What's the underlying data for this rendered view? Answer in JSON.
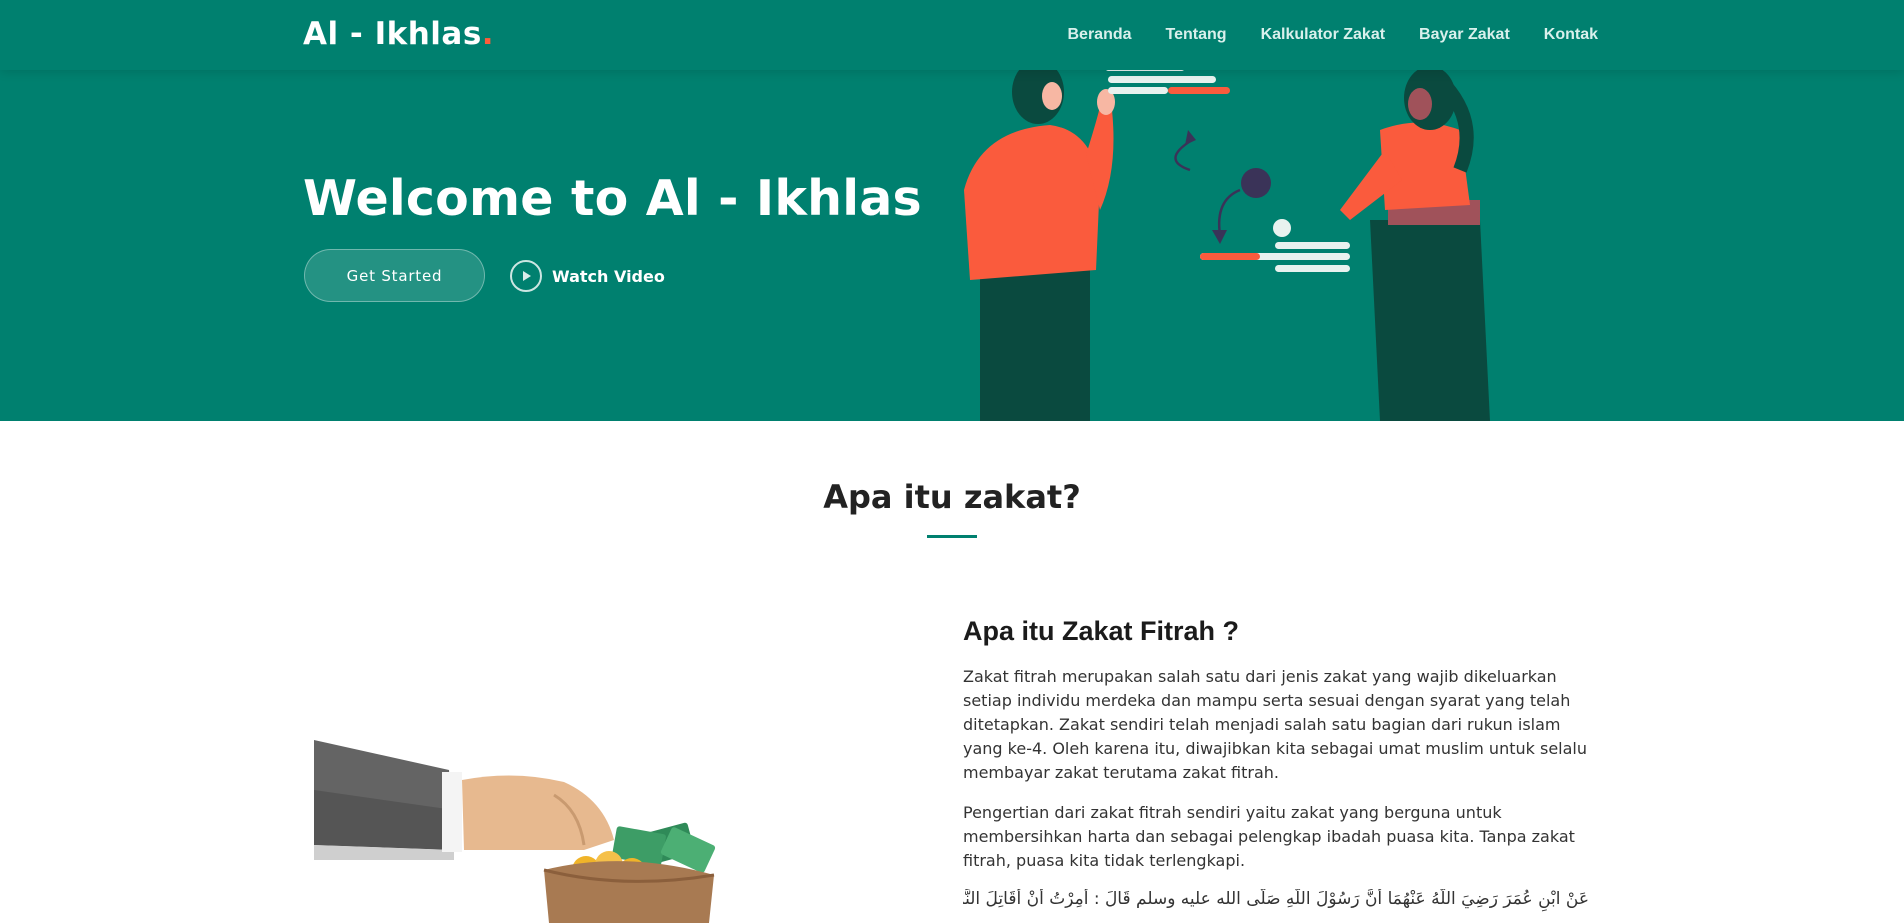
{
  "header": {
    "logo_text": "Al - Ikhlas",
    "logo_dot": ".",
    "nav": [
      {
        "label": "Beranda"
      },
      {
        "label": "Tentang"
      },
      {
        "label": "Kalkulator Zakat"
      },
      {
        "label": "Bayar Zakat"
      },
      {
        "label": "Kontak"
      }
    ]
  },
  "hero": {
    "title": "Welcome to Al - Ikhlas",
    "primary_button": "Get Started",
    "video_button": "Watch Video"
  },
  "section": {
    "title": "Apa itu zakat?"
  },
  "article": {
    "title": "Apa itu Zakat Fitrah ?",
    "paragraphs": [
      "Zakat fitrah merupakan salah satu dari jenis zakat yang wajib dikeluarkan setiap individu merdeka dan mampu serta sesuai dengan syarat yang telah ditetapkan. Zakat sendiri telah menjadi salah satu bagian dari rukun islam yang ke-4. Oleh karena itu, diwajibkan kita sebagai umat muslim untuk selalu membayar zakat terutama zakat fitrah.",
      "Pengertian dari zakat fitrah sendiri yaitu zakat yang berguna untuk membersihkan harta dan sebagai pelengkap ibadah puasa kita. Tanpa zakat fitrah, puasa kita tidak terlengkapi."
    ],
    "arabic": "عَنْ ابْنِ عُمَرَ رَضِيَ اللَّهُ عَنْهُمَا أَنَّ رَسُوْلَ اللَّهِ صَلَّى الله عليه وسلم قَالَ : أُمِرْتُ أَنْ أُقَاتِلَ النَّاسَ حَتَّى"
  },
  "colors": {
    "primary": "#00806f",
    "accent": "#ff5c3a"
  }
}
